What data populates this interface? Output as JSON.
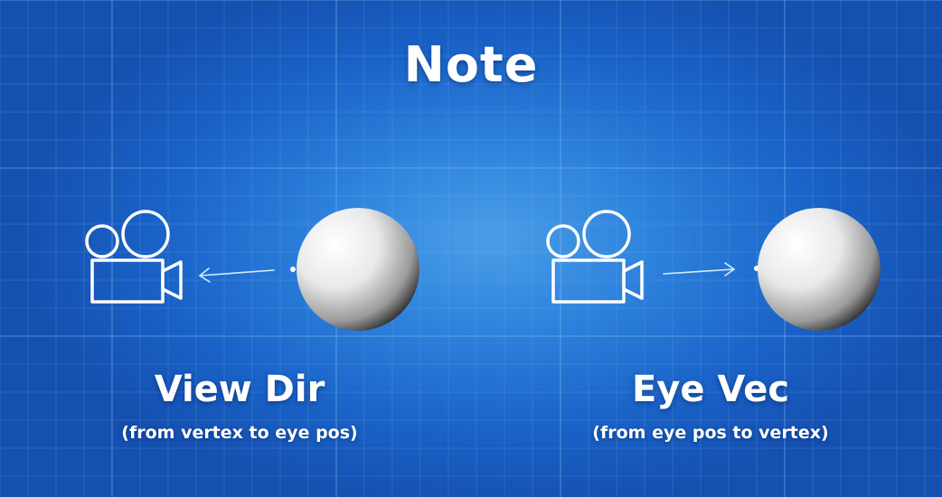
{
  "title": "Note",
  "panels": [
    {
      "label": "View Dir",
      "sublabel": "(from vertex to eye pos)",
      "arrow_direction": "toward camera",
      "camera_icon": "movie-camera-icon"
    },
    {
      "label": "Eye Vec",
      "sublabel": "(from eye pos to vertex)",
      "arrow_direction": "toward sphere",
      "camera_icon": "movie-camera-icon"
    }
  ],
  "colors": {
    "background": "#2d82dc",
    "grid": "#6fb0f0",
    "text": "#ffffff",
    "sphere": "#e8e8e8"
  }
}
